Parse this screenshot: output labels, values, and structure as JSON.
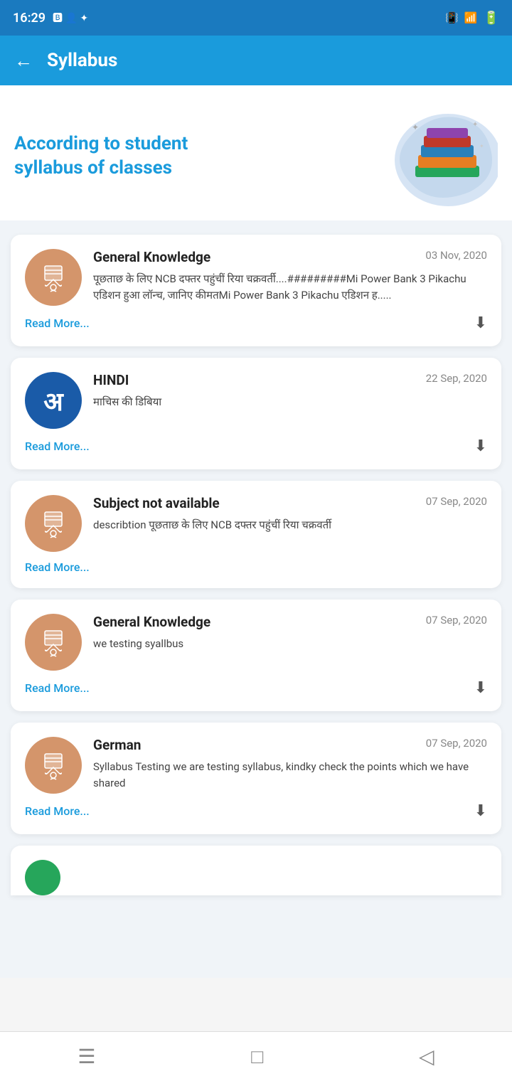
{
  "statusBar": {
    "time": "16:29",
    "icons": [
      "📱",
      "📶",
      "🔋"
    ]
  },
  "header": {
    "back_label": "←",
    "title": "Syllabus"
  },
  "hero": {
    "line1": "According to student",
    "line2": "syllabus of classes"
  },
  "cards": [
    {
      "id": 1,
      "icon_type": "tan",
      "title": "General Knowledge",
      "date": "03 Nov, 2020",
      "description": "पूछताछ के लिए NCB दफ्तर पहुंचीं रिया चक्रवर्ती....#########Mi Power Bank 3 Pikachu एडिशन हुआ लॉन्च, जानिए कीमतMi Power Bank 3 Pikachu एडिशन ह.....",
      "read_more": "Read More...",
      "has_download": true
    },
    {
      "id": 2,
      "icon_type": "blue",
      "title": "HINDI",
      "date": "22 Sep, 2020",
      "description": "माचिस की डिबिया",
      "read_more": "Read More...",
      "has_download": true
    },
    {
      "id": 3,
      "icon_type": "tan",
      "title": "Subject not available",
      "date": "07 Sep, 2020",
      "description": "describtion पूछताछ के लिए NCB दफ्तर पहुंचीं रिया चक्रवर्ती",
      "read_more": "Read More...",
      "has_download": false
    },
    {
      "id": 4,
      "icon_type": "tan",
      "title": "General Knowledge",
      "date": "07 Sep, 2020",
      "description": "we testing syallbus",
      "read_more": "Read More...",
      "has_download": true
    },
    {
      "id": 5,
      "icon_type": "tan",
      "title": "German",
      "date": "07 Sep, 2020",
      "description": "Syllabus Testing we are testing syllabus, kindky check the points which we have shared",
      "read_more": "Read More...",
      "has_download": true
    }
  ],
  "bottomNav": {
    "menu_icon": "☰",
    "home_icon": "□",
    "back_icon": "◁"
  }
}
